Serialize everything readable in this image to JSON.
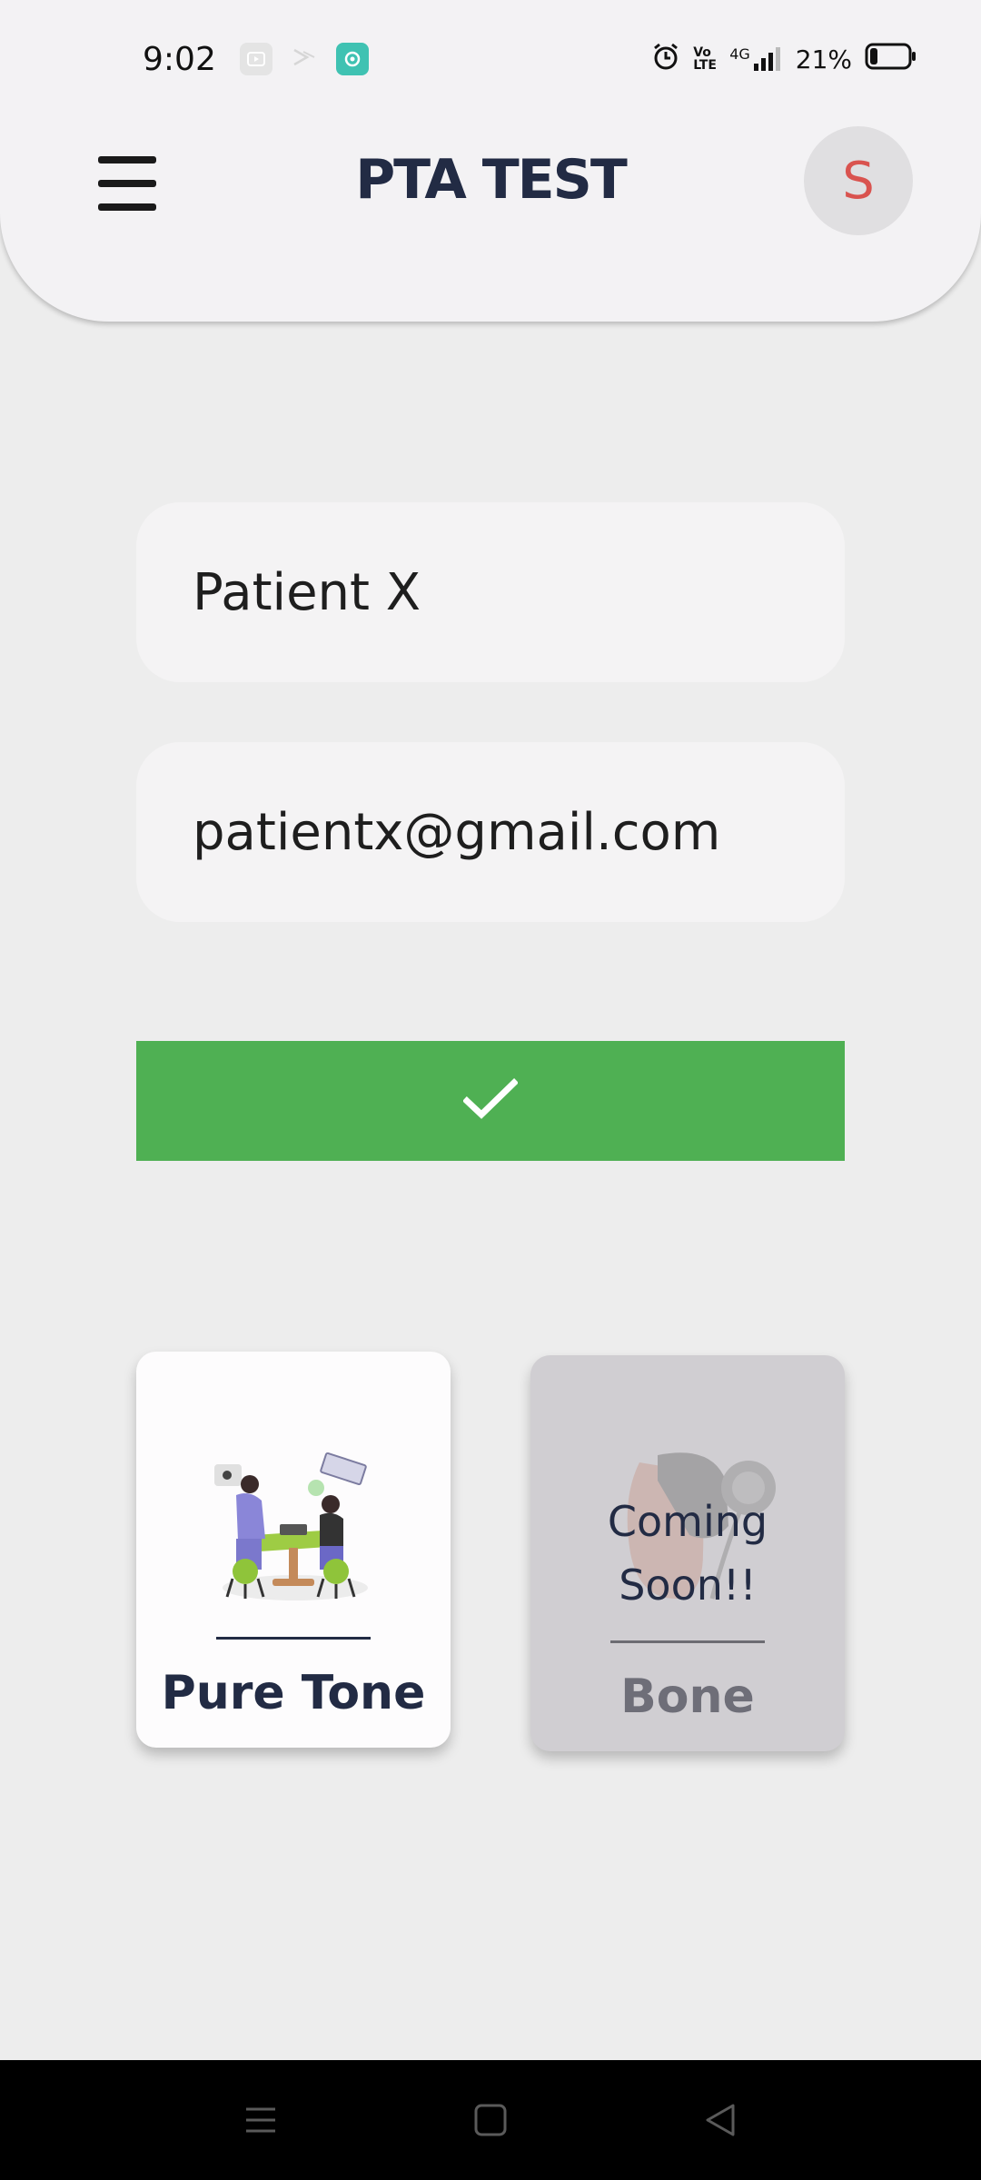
{
  "status_bar": {
    "time": "9:02",
    "network": "4G",
    "volte": "Vo LTE",
    "battery_percent": "21%",
    "battery_level": 0.21
  },
  "app_bar": {
    "title": "PTA TEST",
    "avatar_initial": "S"
  },
  "form": {
    "name_value": "Patient X",
    "email_value": "patientx@gmail.com"
  },
  "cards": {
    "pure_tone": {
      "label": "Pure Tone"
    },
    "bone": {
      "label": "Bone",
      "overlay": "Coming Soon!!"
    }
  },
  "colors": {
    "accent_green": "#4fb053",
    "title_navy": "#222b44",
    "avatar_red": "#d9534f",
    "background": "#ededed"
  },
  "icons": {
    "menu": "hamburger-menu-icon",
    "submit": "checkmark-icon",
    "nav_recent": "recent-apps-icon",
    "nav_home": "home-icon",
    "nav_back": "back-icon"
  }
}
